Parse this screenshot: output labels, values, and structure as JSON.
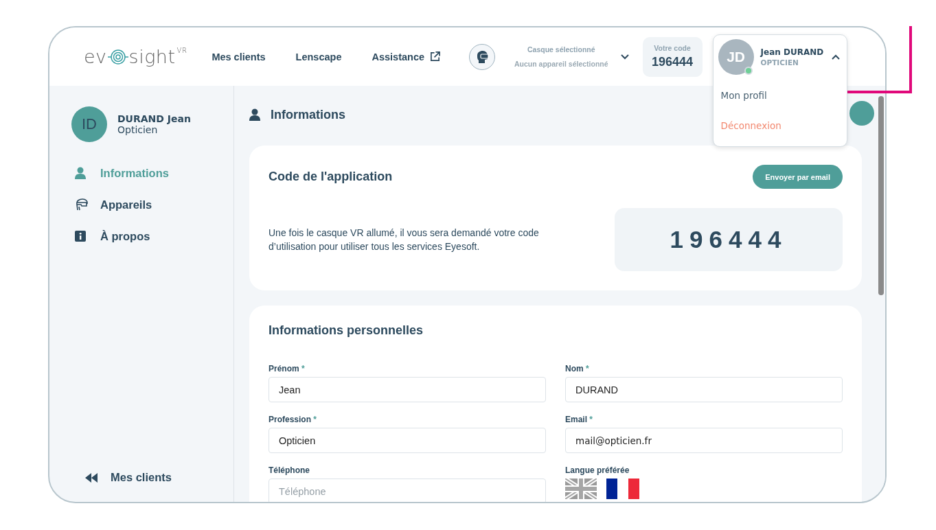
{
  "header": {
    "logo": {
      "before": "ev",
      "after": "sight",
      "superscript": "VR"
    },
    "nav": [
      {
        "label": "Mes clients",
        "external": false
      },
      {
        "label": "Lenscape",
        "external": false
      },
      {
        "label": "Assistance",
        "external": true
      }
    ],
    "device_selector": {
      "label": "Casque sélectionné",
      "value": "Aucun appareil sélectionné"
    },
    "code_box": {
      "label": "Votre code",
      "value": "196444"
    },
    "user_menu": {
      "initials": "JD",
      "name": "Jean DURAND",
      "role": "OPTICIEN",
      "online": true,
      "expanded": true,
      "items": [
        {
          "label": "Mon profil",
          "kind": "normal"
        },
        {
          "label": "Déconnexion",
          "kind": "danger"
        }
      ]
    }
  },
  "sidebar": {
    "profile": {
      "initials": "ID",
      "name": "DURAND Jean",
      "role": "Opticien"
    },
    "items": [
      {
        "label": "Informations",
        "selected": true
      },
      {
        "label": "Appareils",
        "selected": false
      },
      {
        "label": "À propos",
        "selected": false
      }
    ],
    "back_link": "Mes clients"
  },
  "main": {
    "title": "Informations",
    "app_code_card": {
      "title": "Code de l'application",
      "button": "Envoyer par email",
      "description": "Une fois le casque VR allumé, il vous sera demandé votre code d’utilisation pour utiliser tous les services Eyesoft.",
      "code": "196444"
    },
    "personal_card": {
      "title": "Informations personnelles",
      "fields": [
        {
          "label": "Prénom",
          "required_mark": "*",
          "value": "Jean"
        },
        {
          "label": "Nom",
          "required_mark": "*",
          "value": "DURAND"
        },
        {
          "label": "Profession",
          "required_mark": "*",
          "value": "Opticien"
        },
        {
          "label": "Email",
          "required_mark": "*",
          "value": "mail@opticien.fr"
        },
        {
          "label": "Téléphone",
          "placeholder": "Téléphone"
        }
      ],
      "language": {
        "label": "Langue préférée",
        "options": [
          {
            "kind": "uk",
            "selected": false
          },
          {
            "kind": "fr",
            "selected": true
          }
        ]
      }
    }
  }
}
